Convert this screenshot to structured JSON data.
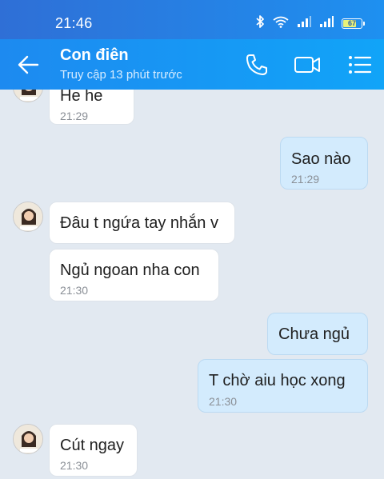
{
  "status_bar": {
    "time": "21:46",
    "battery": "67",
    "icons": [
      "bluetooth-icon",
      "wifi-icon",
      "signal-icon",
      "signal-icon",
      "battery-icon"
    ]
  },
  "header": {
    "contact_name": "Con điên",
    "last_seen": "Truy cập 13 phút trước",
    "icons": [
      "back-arrow-icon",
      "phone-icon",
      "video-camera-icon",
      "list-menu-icon"
    ]
  },
  "messages": [
    {
      "direction": "incoming",
      "text": "He he",
      "time": "21:29"
    },
    {
      "direction": "outgoing",
      "text": "Sao nào",
      "time": "21:29"
    },
    {
      "direction": "incoming",
      "text": "Đâu t ngứa tay nhắn v",
      "time": ""
    },
    {
      "direction": "incoming",
      "text": "Ngủ ngoan nha con",
      "time": "21:30"
    },
    {
      "direction": "outgoing",
      "text": "Chưa ngủ",
      "time": ""
    },
    {
      "direction": "outgoing",
      "text": "T chờ aiu học xong",
      "time": "21:30"
    },
    {
      "direction": "incoming",
      "text": "Cút ngay",
      "time": "21:30"
    }
  ],
  "colors": {
    "header": "#1d8af0",
    "chat_background": "#e2e9f1",
    "incoming_bubble": "#ffffff",
    "outgoing_bubble": "#d3ebfd",
    "battery_fill": "#e8f27a"
  }
}
